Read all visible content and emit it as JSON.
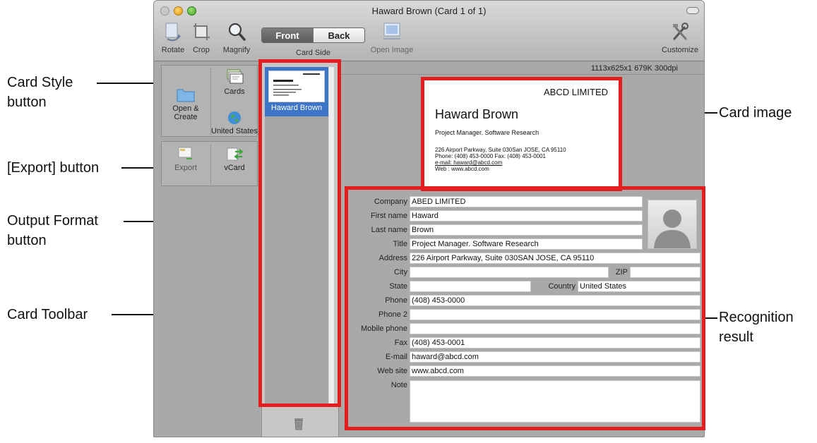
{
  "callouts": {
    "card_style": [
      "Card Style",
      "button"
    ],
    "export_button": "[Export] button",
    "output_format": [
      "Output Format",
      "button"
    ],
    "card_toolbar": "Card Toolbar",
    "card_image": "Card image",
    "recognition_result": [
      "Recognition",
      "result"
    ]
  },
  "window": {
    "title": "Haward Brown (Card 1 of 1)"
  },
  "toolbar": {
    "rotate": "Rotate",
    "crop": "Crop",
    "magnify": "Magnify",
    "card_side": {
      "front": "Front",
      "back": "Back",
      "label": "Card Side"
    },
    "open_image": "Open Image",
    "customize": "Customize"
  },
  "tools": {
    "open_create": [
      "Open &",
      "Create"
    ],
    "cards": "Cards",
    "united_states": "United States",
    "export": "Export",
    "vcard": "vCard"
  },
  "thumbnail": {
    "name": "Haward Brown"
  },
  "info": "1113x625x1  679K  300dpi",
  "card_image": {
    "company": "ABCD LIMITED",
    "name": "Haward Brown",
    "title": "Project Manager. Software Research",
    "address": "226 Airport Parkway, Suite 030San JOSE, CA 95110",
    "phone_line": "Phone: (408) 453-0000      Fax: (408) 453-0001",
    "email_line": "e-mail: haward@abcd.com",
    "web_line": "Web   : www.abcd.com"
  },
  "form": {
    "fields": [
      {
        "label": "Company",
        "value": "ABED LIMITED"
      },
      {
        "label": "First name",
        "value": "Haward"
      },
      {
        "label": "Last name",
        "value": "Brown"
      },
      {
        "label": "Title",
        "value": "Project Manager. Software Research"
      },
      {
        "label": "Address",
        "value": "226 Airport Parkway, Suite 030SAN JOSE, CA 95110"
      },
      {
        "label": "City",
        "value": "",
        "zip_label": "ZIP",
        "zip": ""
      },
      {
        "label": "State",
        "value": "",
        "country_label": "Country",
        "country": "United States"
      },
      {
        "label": "Phone",
        "value": "(408) 453-0000"
      },
      {
        "label": "Phone 2",
        "value": ""
      },
      {
        "label": "Mobile phone",
        "value": ""
      },
      {
        "label": "Fax",
        "value": "(408) 453-0001"
      },
      {
        "label": "E-mail",
        "value": "haward@abcd.com"
      },
      {
        "label": "Web site",
        "value": "www.abcd.com"
      },
      {
        "label": "Note",
        "value": ""
      }
    ]
  },
  "colors": {
    "highlight_red": "#e41e1e",
    "selection_blue": "#3d76c9"
  }
}
